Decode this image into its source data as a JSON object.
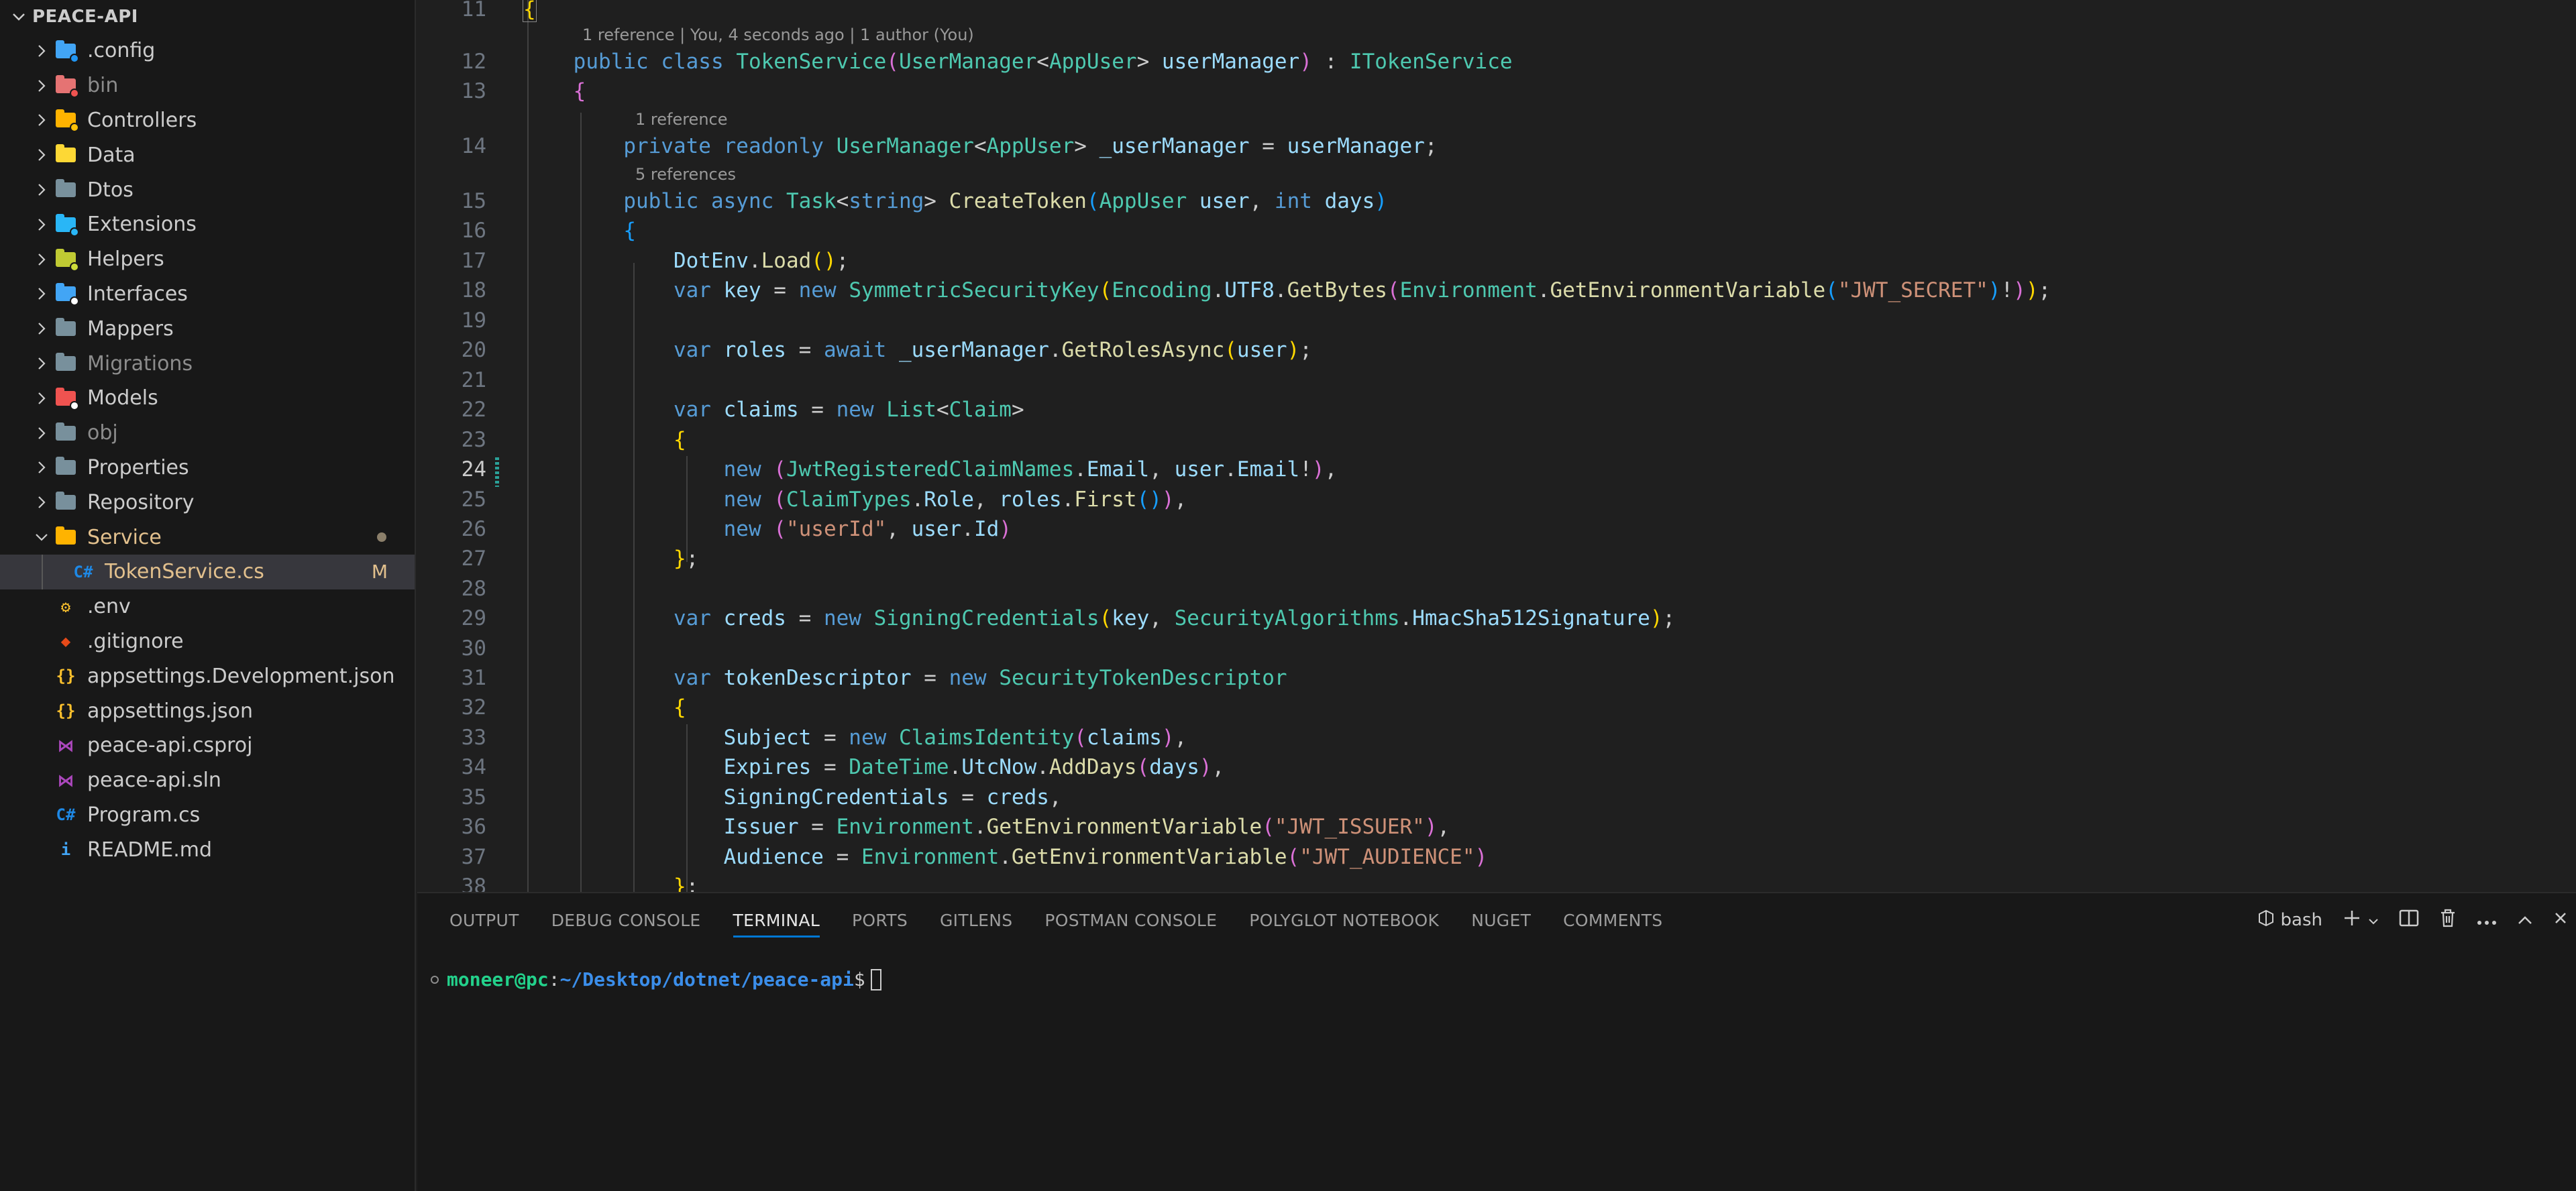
{
  "explorer": {
    "root_label": "PEACE-API",
    "items": [
      {
        "label": ".config",
        "kind": "folder",
        "color": "#42a5f5",
        "badge_color": "#2196f3",
        "dim": false
      },
      {
        "label": "bin",
        "kind": "folder",
        "color": "#e57373",
        "badge_color": "#ef5350",
        "dim": true
      },
      {
        "label": "Controllers",
        "kind": "folder",
        "color": "#ffb300",
        "badge_color": "#ffc107",
        "dim": false
      },
      {
        "label": "Data",
        "kind": "folder",
        "color": "#fdd835",
        "badge_color": "",
        "dim": false
      },
      {
        "label": "Dtos",
        "kind": "folder",
        "color": "#78909c",
        "badge_color": "",
        "dim": false
      },
      {
        "label": "Extensions",
        "kind": "folder",
        "color": "#29b6f6",
        "badge_color": "#29b6f6",
        "dim": false
      },
      {
        "label": "Helpers",
        "kind": "folder",
        "color": "#c0ca33",
        "badge_color": "#cddc39",
        "dim": false
      },
      {
        "label": "Interfaces",
        "kind": "folder",
        "color": "#42a5f5",
        "badge_color": "#ffffff",
        "dim": false
      },
      {
        "label": "Mappers",
        "kind": "folder",
        "color": "#78909c",
        "badge_color": "",
        "dim": false
      },
      {
        "label": "Migrations",
        "kind": "folder",
        "color": "#78909c",
        "badge_color": "",
        "dim": true
      },
      {
        "label": "Models",
        "kind": "folder",
        "color": "#ef5350",
        "badge_color": "#ffffff",
        "dim": false
      },
      {
        "label": "obj",
        "kind": "folder",
        "color": "#78909c",
        "badge_color": "",
        "dim": true
      },
      {
        "label": "Properties",
        "kind": "folder",
        "color": "#78909c",
        "badge_color": "",
        "dim": false
      },
      {
        "label": "Repository",
        "kind": "folder",
        "color": "#78909c",
        "badge_color": "",
        "dim": false
      },
      {
        "label": "Service",
        "kind": "folder-open",
        "color": "#ffb300",
        "badge_color": "",
        "dim": false
      }
    ],
    "selected_file": {
      "label": "TokenService.cs",
      "badge": "M"
    },
    "files": [
      {
        "label": ".env",
        "icon": "env-icon",
        "glyph": "⚙",
        "color": "#fbc02d"
      },
      {
        "label": ".gitignore",
        "icon": "git-icon",
        "glyph": "◆",
        "color": "#e64a19"
      },
      {
        "label": "appsettings.Development.json",
        "icon": "json-icon",
        "glyph": "{}",
        "color": "#fbc02d"
      },
      {
        "label": "appsettings.json",
        "icon": "json-icon",
        "glyph": "{}",
        "color": "#fbc02d"
      },
      {
        "label": "peace-api.csproj",
        "icon": "visual-studio-icon",
        "glyph": "⋈",
        "color": "#ab47bc"
      },
      {
        "label": "peace-api.sln",
        "icon": "visual-studio-icon",
        "glyph": "⋈",
        "color": "#ab47bc"
      },
      {
        "label": "Program.cs",
        "icon": "csharp-icon",
        "glyph": "C#",
        "color": "#1e88e5"
      },
      {
        "label": "README.md",
        "icon": "info-icon",
        "glyph": "i",
        "color": "#42a5f5"
      }
    ]
  },
  "editor": {
    "codelens": {
      "class": "1 reference | You, 4 seconds ago | 1 author (You)",
      "field": "1 reference",
      "method": "5 references"
    },
    "line_numbers": [
      "11",
      "12",
      "13",
      "14",
      "15",
      "16",
      "17",
      "18",
      "19",
      "20",
      "21",
      "22",
      "23",
      "24",
      "25",
      "26",
      "27",
      "28",
      "29",
      "30",
      "31",
      "32",
      "33",
      "34",
      "35",
      "36",
      "37",
      "38"
    ]
  },
  "panel": {
    "tabs": [
      "OUTPUT",
      "DEBUG CONSOLE",
      "TERMINAL",
      "PORTS",
      "GITLENS",
      "POSTMAN CONSOLE",
      "POLYGLOT NOTEBOOK",
      "NUGET",
      "COMMENTS"
    ],
    "active_tab": "TERMINAL",
    "shell": "bash",
    "terminal": {
      "user": "moneer@pc",
      "sep": ":",
      "path": "~/Desktop/dotnet/peace-api",
      "prompt": "$"
    }
  }
}
